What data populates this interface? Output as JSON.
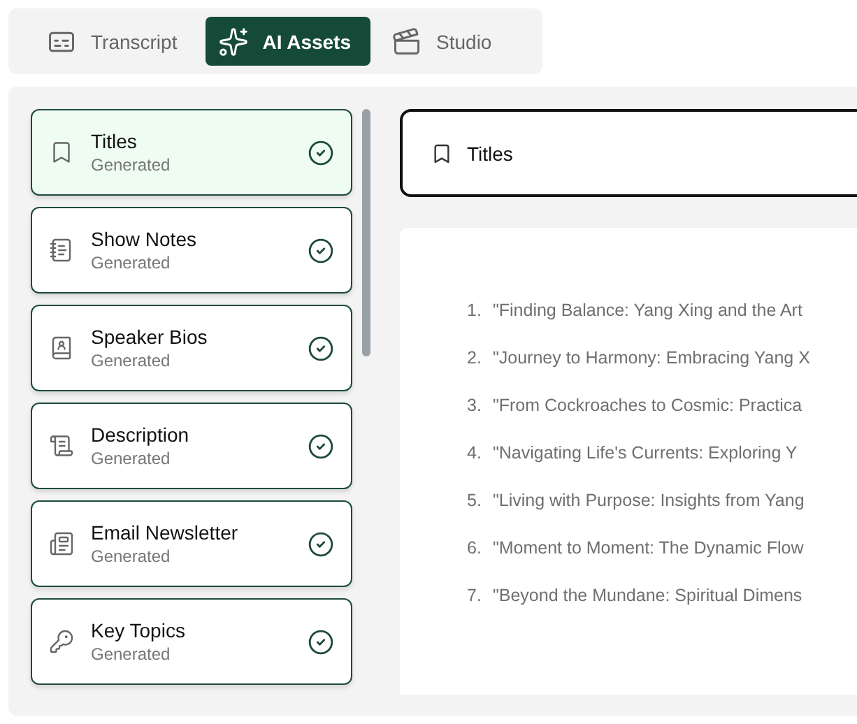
{
  "tabs": [
    {
      "label": "Transcript",
      "selected": false
    },
    {
      "label": "AI Assets",
      "selected": true
    },
    {
      "label": "Studio",
      "selected": false
    }
  ],
  "assets": [
    {
      "title": "Titles",
      "status": "Generated",
      "done": true,
      "selected": true
    },
    {
      "title": "Show Notes",
      "status": "Generated",
      "done": true,
      "selected": false
    },
    {
      "title": "Speaker Bios",
      "status": "Generated",
      "done": true,
      "selected": false
    },
    {
      "title": "Description",
      "status": "Generated",
      "done": true,
      "selected": false
    },
    {
      "title": "Email Newsletter",
      "status": "Generated",
      "done": true,
      "selected": false
    },
    {
      "title": "Key Topics",
      "status": "Generated",
      "done": true,
      "selected": false
    }
  ],
  "detail": {
    "title": "Titles",
    "items": [
      {
        "number": "1.",
        "text": "\"Finding Balance: Yang Xing and the Art"
      },
      {
        "number": "2.",
        "text": "\"Journey to Harmony: Embracing Yang X"
      },
      {
        "number": "3.",
        "text": "\"From Cockroaches to Cosmic: Practica"
      },
      {
        "number": "4.",
        "text": "\"Navigating Life's Currents: Exploring Y"
      },
      {
        "number": "5.",
        "text": "\"Living with Purpose: Insights from Yang"
      },
      {
        "number": "6.",
        "text": "\"Moment to Moment: The Dynamic Flow"
      },
      {
        "number": "7.",
        "text": "\"Beyond the Mundane: Spiritual Dimens"
      }
    ]
  }
}
